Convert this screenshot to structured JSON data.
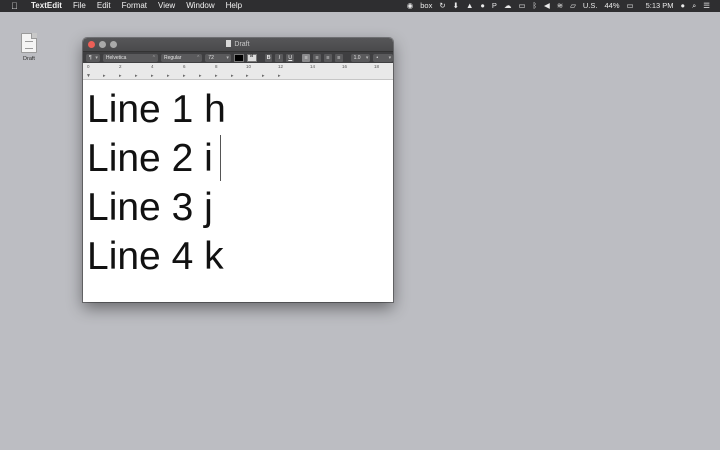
{
  "menubar": {
    "app_name": "TextEdit",
    "items": [
      "File",
      "Edit",
      "Format",
      "View",
      "Window",
      "Help"
    ],
    "status": {
      "box": "box",
      "keyboard": "U.S.",
      "battery": "44%",
      "time": "5:13 PM"
    }
  },
  "desktop": {
    "icon_label": "Draft"
  },
  "window": {
    "title": "Draft",
    "toolbar": {
      "paragraph_style": "¶",
      "font_family": "Helvetica",
      "font_style": "Regular",
      "font_size": "72",
      "line_spacing": "1.0",
      "list_style": "•"
    },
    "ruler": {
      "labels": [
        "0",
        "2",
        "4",
        "6",
        "8",
        "10",
        "12",
        "14",
        "16",
        "18"
      ]
    },
    "document": {
      "lines": [
        "Line 1 h",
        "Line 2 i",
        "Line 3 j",
        "Line 4 k"
      ]
    }
  },
  "colors": {
    "desktop": "#bcbdc2",
    "menubar": "#2e2e30",
    "close_button": "#ec5f57"
  }
}
